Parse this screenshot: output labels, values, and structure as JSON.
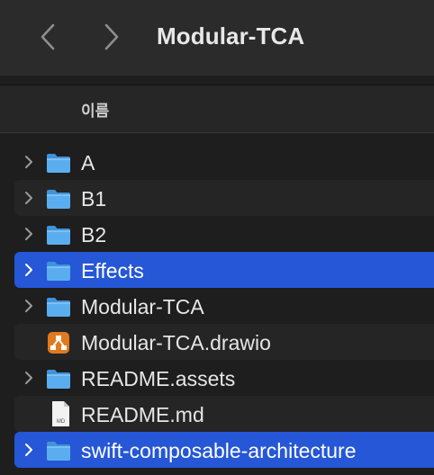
{
  "window": {
    "title": "Modular-TCA"
  },
  "toolbar": {
    "back_icon": "chevron-left-icon",
    "forward_icon": "chevron-right-icon"
  },
  "columns": {
    "name_header": "이름"
  },
  "colors": {
    "selection": "#2557d6",
    "folder": "#5aaef0",
    "drawio": "#e07a1f"
  },
  "files": [
    {
      "name": "A",
      "kind": "folder",
      "expandable": true,
      "selected": false
    },
    {
      "name": "B1",
      "kind": "folder",
      "expandable": true,
      "selected": false
    },
    {
      "name": "B2",
      "kind": "folder",
      "expandable": true,
      "selected": false
    },
    {
      "name": "Effects",
      "kind": "folder",
      "expandable": true,
      "selected": true
    },
    {
      "name": "Modular-TCA",
      "kind": "folder",
      "expandable": true,
      "selected": false
    },
    {
      "name": "Modular-TCA.drawio",
      "kind": "drawio",
      "expandable": false,
      "selected": false
    },
    {
      "name": "README.assets",
      "kind": "folder",
      "expandable": true,
      "selected": false
    },
    {
      "name": "README.md",
      "kind": "markdown",
      "icon_label": "MD",
      "expandable": false,
      "selected": false
    },
    {
      "name": "swift-composable-architecture",
      "kind": "folder",
      "expandable": true,
      "selected": true
    }
  ]
}
